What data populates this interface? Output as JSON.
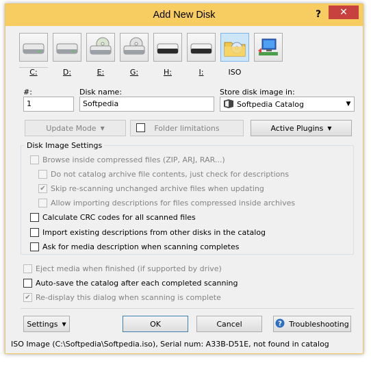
{
  "window": {
    "title": "Add New Disk",
    "help": "?",
    "close": "✕"
  },
  "drives": [
    {
      "label": "C:",
      "icon": "hard-drive-icon"
    },
    {
      "label": "D:",
      "icon": "hard-drive-icon"
    },
    {
      "label": "E:",
      "icon": "cd-drive-icon"
    },
    {
      "label": "G:",
      "icon": "cd-drive-icon"
    },
    {
      "label": "H:",
      "icon": "removable-drive-icon"
    },
    {
      "label": "I:",
      "icon": "removable-drive-icon"
    },
    {
      "label": "ISO",
      "icon": "iso-folder-icon"
    },
    {
      "label": "",
      "icon": "network-drive-icon"
    }
  ],
  "fields": {
    "number_label": "#:",
    "number_value": "1",
    "disk_name_label": "Disk name:",
    "disk_name_value": "Softpedia",
    "store_label": "Store disk image in:",
    "store_value": "Softpedia Catalog"
  },
  "buttons": {
    "update_mode": "Update Mode",
    "folder_limitations": "Folder limitations",
    "active_plugins": "Active Plugins",
    "settings": "Settings",
    "ok": "OK",
    "cancel": "Cancel",
    "troubleshooting": "Troubleshooting"
  },
  "disk_image_settings": {
    "title": "Disk Image Settings",
    "options": [
      {
        "label": "Browse inside compressed files (ZIP, ARJ, RAR...)",
        "checked": false,
        "disabled": true
      },
      {
        "label": "Do not catalog archive file contents, just check for descriptions",
        "checked": false,
        "disabled": true
      },
      {
        "label": "Skip re-scanning unchanged archive files when updating",
        "checked": true,
        "disabled": true
      },
      {
        "label": "Allow importing descriptions for files compressed inside archives",
        "checked": false,
        "disabled": true
      },
      {
        "label": "Calculate CRC codes for all scanned files",
        "checked": false,
        "disabled": false
      },
      {
        "label": "Import existing descriptions from other disks in the catalog",
        "checked": false,
        "disabled": false
      },
      {
        "label": "Ask for media description when scanning completes",
        "checked": false,
        "disabled": false
      }
    ]
  },
  "general_options": [
    {
      "label": "Eject media when finished (if supported by drive)",
      "checked": false,
      "disabled": true
    },
    {
      "label": "Auto-save the catalog after each completed scanning",
      "checked": false,
      "disabled": false
    },
    {
      "label": "Re-display this dialog when scanning is complete",
      "checked": true,
      "disabled": true
    }
  ],
  "status": "ISO Image (C:\\Softpedia\\Softpedia.iso), Serial num: A33B-D51E, not found in catalog"
}
